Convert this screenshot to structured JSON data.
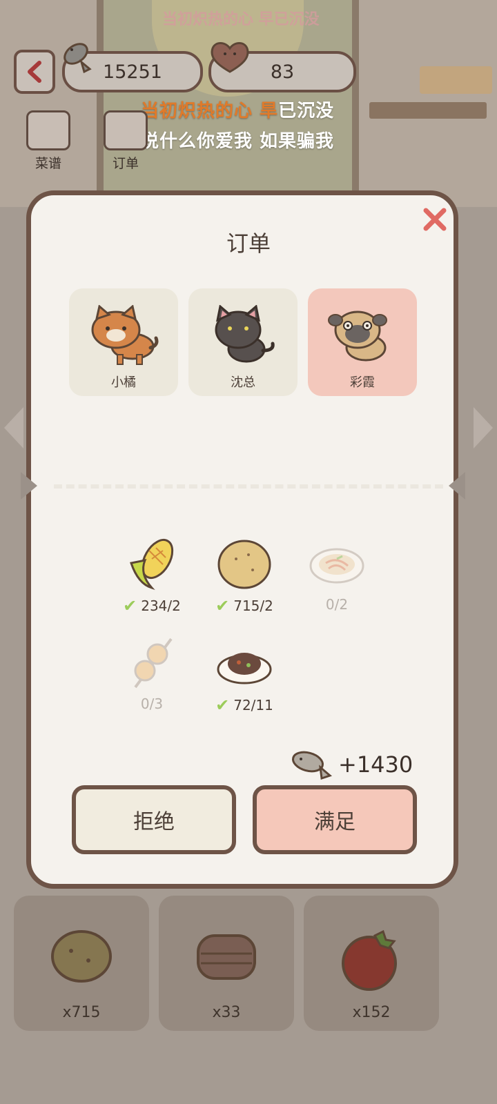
{
  "header": {
    "fish_currency": "15251",
    "hearts": "83",
    "ghost_lyric": "当初炽热的心 早已沉没",
    "lyric_line1_highlight": "当初炽热的心 旱",
    "lyric_line1_rest": "已沉没",
    "lyric_line2": "说什么你爱我 如果骗我"
  },
  "side_buttons": {
    "recipes_label": "菜谱",
    "orders_label": "订单"
  },
  "modal": {
    "title": "订单",
    "customers": [
      {
        "name": "小橘",
        "selected": false
      },
      {
        "name": "沈总",
        "selected": false
      },
      {
        "name": "彩霞",
        "selected": true
      }
    ],
    "items": [
      {
        "icon": "corn-icon",
        "qty": "234/2",
        "met": true
      },
      {
        "icon": "potato-icon",
        "qty": "715/2",
        "met": true
      },
      {
        "icon": "noodles-plate-icon",
        "qty": "0/2",
        "met": false
      },
      {
        "icon": "skewer-icon",
        "qty": "0/3",
        "met": false
      },
      {
        "icon": "stew-plate-icon",
        "qty": "72/11",
        "met": true
      }
    ],
    "reward": "+1430",
    "reject_label": "拒绝",
    "accept_label": "满足"
  },
  "inventory": [
    {
      "icon": "potato-icon",
      "count": "x715"
    },
    {
      "icon": "meat-icon",
      "count": "x33"
    },
    {
      "icon": "tomato-icon",
      "count": "x152"
    }
  ],
  "colors": {
    "border": "#6e5447",
    "modal_bg": "#f5f2ed",
    "accept": "#f5c8ba",
    "reject": "#f1ecdf",
    "check": "#9ccc5a"
  }
}
